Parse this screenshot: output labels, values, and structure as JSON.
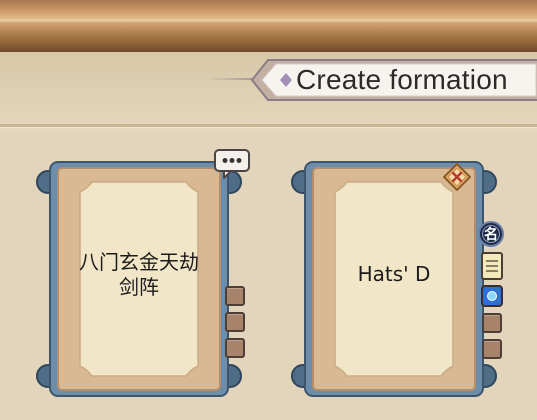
{
  "header": {
    "title": "Create formation"
  },
  "formations": [
    {
      "name": "八门玄金天劫\n剑阵",
      "has_chat": true,
      "has_badge": false
    },
    {
      "name": "Hats' D",
      "has_chat": false,
      "has_badge": true
    }
  ],
  "side_buttons": {
    "name_badge_glyph": "名"
  },
  "colors": {
    "frame_blue": "#5f7f9c",
    "paper": "#f1e7c8",
    "wood": "#b98957"
  }
}
